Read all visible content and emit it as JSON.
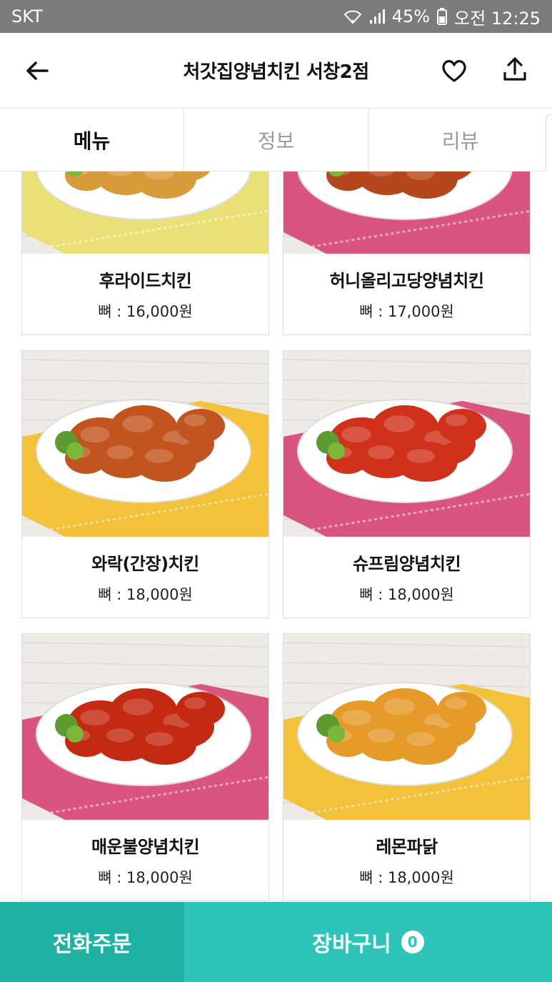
{
  "status_bar": {
    "carrier": "SKT",
    "battery": "45%",
    "time": "오전 12:25"
  },
  "header": {
    "title": "처갓집양념치킨 서창2점",
    "icons": [
      "back-arrow-icon",
      "heart-icon",
      "share-icon"
    ]
  },
  "tabs": [
    {
      "label": "메뉴",
      "active": true
    },
    {
      "label": "정보",
      "active": false
    },
    {
      "label": "리뷰",
      "active": false
    }
  ],
  "menu": [
    {
      "name": "후라이드치킨",
      "price": "뼈 : 16,000원",
      "mat_color": "#e9e077",
      "sauce_color": "#d99a3a"
    },
    {
      "name": "허니올리고당양념치킨",
      "price": "뼈 : 17,000원",
      "mat_color": "#d9547e",
      "sauce_color": "#b5471d"
    },
    {
      "name": "와락(간장)치킨",
      "price": "뼈 : 18,000원",
      "mat_color": "#f2c23a",
      "sauce_color": "#c2551f"
    },
    {
      "name": "슈프림양념치킨",
      "price": "뼈 : 18,000원",
      "mat_color": "#d9547e",
      "sauce_color": "#d0311a"
    },
    {
      "name": "매운불양념치킨",
      "price": "뼈 : 18,000원",
      "mat_color": "#d9547e",
      "sauce_color": "#c42a12"
    },
    {
      "name": "레몬파닭",
      "price": "뼈 : 18,000원",
      "mat_color": "#f2c23a",
      "sauce_color": "#e69a2a"
    }
  ],
  "bottom_bar": {
    "call_label": "전화주문",
    "cart_label": "장바구니",
    "cart_count": "0"
  },
  "colors": {
    "accent": "#2ec4b9",
    "accent_dark": "#20b0a4",
    "statusbar": "#7b7b7b"
  }
}
